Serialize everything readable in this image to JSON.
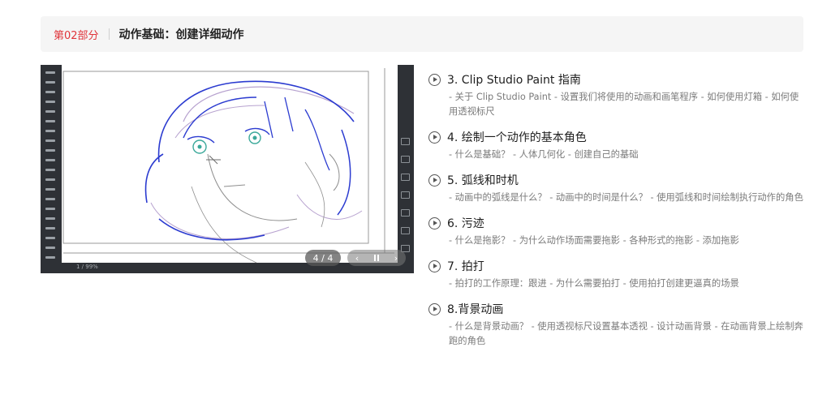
{
  "section": {
    "part_label": "第02部分",
    "title": "动作基础：创建详细动作"
  },
  "media": {
    "counter": "4 / 4",
    "prev_glyph": "‹",
    "next_glyph": "›",
    "bottom_status": "1 / 99%"
  },
  "lessons": [
    {
      "title": "3. Clip Studio Paint 指南",
      "desc": "- 关于 Clip Studio Paint - 设置我们将使用的动画和画笔程序 - 如何使用灯箱 - 如何使用透视标尺"
    },
    {
      "title": "4. 绘制一个动作的基本角色",
      "desc": "- 什么是基础？ - 人体几何化 - 创建自己的基础"
    },
    {
      "title": "5. 弧线和时机",
      "desc": "- 动画中的弧线是什么？ - 动画中的时间是什么？ - 使用弧线和时间绘制执行动作的角色"
    },
    {
      "title": "6. 污迹",
      "desc": "- 什么是拖影？ - 为什么动作场面需要拖影 - 各种形式的拖影 - 添加拖影"
    },
    {
      "title": "7. 拍打",
      "desc": "- 拍打的工作原理：跟进 - 为什么需要拍打 - 使用拍打创建更逼真的场景"
    },
    {
      "title": "8.背景动画",
      "desc": "- 什么是背景动画？ - 使用透视标尺设置基本透视 - 设计动画背景 - 在动画背景上绘制奔跑的角色"
    }
  ],
  "colors": {
    "accent": "#e0343a",
    "sketch_blue": "#2b3bd0",
    "sketch_purple": "#b7a2cf",
    "sketch_gray": "#8e8e8e",
    "eye_teal": "#3aa89a"
  }
}
